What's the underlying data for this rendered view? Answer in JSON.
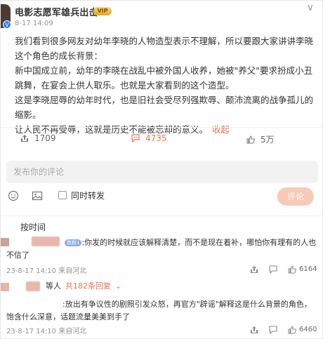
{
  "post": {
    "author": "电影志愿军雄兵出击",
    "vip_badge": "VIP",
    "verified_badge": "V",
    "time": "8-17 14:09",
    "more": "∨",
    "paragraphs": [
      "我们看到很多网友对幼年李晓的人物造型表示不理解，所以要跟大家讲讲李晓这个角色的成长背景：",
      "新中国成立前，幼年的李晓在战乱中被外国人收养，她被\"养父\"要求扮成小丑跳舞，在宴会上供人取乐。也就是大家看到的这个造型。",
      "这是李晓屈辱的幼年时代，也是旧社会受尽列强欺辱、颠沛流离的战争孤儿的缩影。",
      "让人民不再受辱，这就是历史不能被忘却的意义。"
    ],
    "collapse_label": "收起"
  },
  "actions": {
    "share_count": "1709",
    "comment_count": "4735",
    "like_count": "5万"
  },
  "compose": {
    "placeholder": "发布你的评论",
    "repost_label": "同时转发",
    "submit_label": "评论"
  },
  "sort": {
    "label": "按时间"
  },
  "comments": [
    {
      "fan_badge": "铁粉1",
      "text": ":你发的时候就应该解释清楚，而不是现在着补，哪怕你有理有的人也不信了",
      "time": "23-8-17 14:10 来自河北",
      "likes": "6164"
    },
    {
      "reply_prefix": "等人",
      "reply_count": "共182条回复",
      "text": ":放出有争议性的剧照引发众怒，再官方\"辟谣\"解释这是什么背景的角色，饱含什么深意，话题流量美美到手了",
      "time": "23-8-17 14:10 来自河北",
      "likes": "6460"
    }
  ],
  "colors": {
    "accent": "#eb7350",
    "verified": "#2f7be5",
    "button_disabled": "#f7c9b7"
  }
}
